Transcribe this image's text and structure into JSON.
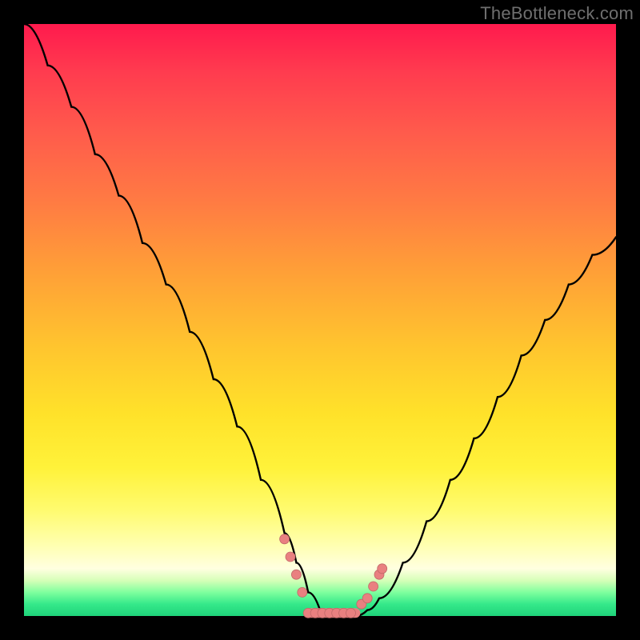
{
  "watermark": "TheBottleneck.com",
  "colors": {
    "frame": "#000000",
    "curve": "#000000",
    "marker_fill": "#e98080",
    "marker_stroke": "#c06868",
    "gradient_stops": [
      "#ff1a4d",
      "#ff3b4f",
      "#ff5a4c",
      "#ff7b43",
      "#ffa037",
      "#ffc62e",
      "#ffe22a",
      "#fff23a",
      "#fffb6e",
      "#ffffb0",
      "#ffffe0",
      "#d6ffb8",
      "#7fff9e",
      "#35e98a",
      "#1fd37a"
    ]
  },
  "chart_data": {
    "type": "line",
    "title": "",
    "xlabel": "",
    "ylabel": "",
    "xlim": [
      0,
      100
    ],
    "ylim": [
      0,
      100
    ],
    "x": [
      0,
      4,
      8,
      12,
      16,
      20,
      24,
      28,
      32,
      36,
      40,
      44,
      46,
      48,
      50,
      52,
      54,
      56,
      58,
      60,
      64,
      68,
      72,
      76,
      80,
      84,
      88,
      92,
      96,
      100
    ],
    "values": [
      100,
      93,
      86,
      78,
      71,
      63,
      56,
      48,
      40,
      32,
      23,
      14,
      9,
      4,
      1,
      0,
      0,
      0,
      1,
      3,
      9,
      16,
      23,
      30,
      37,
      44,
      50,
      56,
      61,
      64
    ],
    "markers": {
      "left_cluster": [
        [
          44,
          13
        ],
        [
          45,
          10
        ],
        [
          46,
          7
        ],
        [
          47,
          4
        ]
      ],
      "right_cluster": [
        [
          57,
          2
        ],
        [
          58,
          3
        ],
        [
          59,
          5
        ],
        [
          60,
          7
        ],
        [
          60.5,
          8
        ]
      ],
      "bottom_segment_x": [
        48,
        56
      ],
      "bottom_segment_y": 0.5
    }
  }
}
